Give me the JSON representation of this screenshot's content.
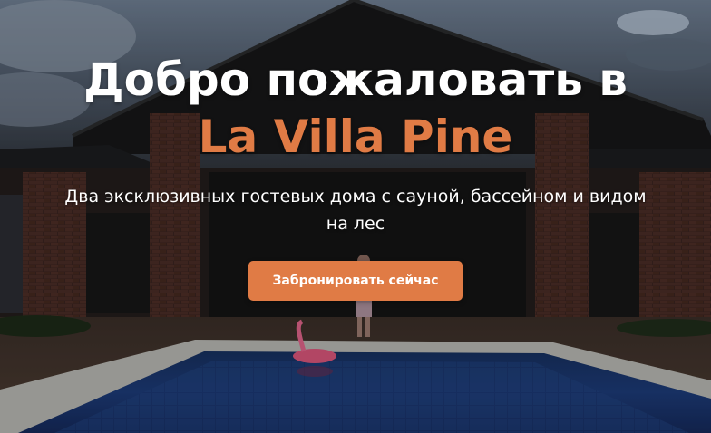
{
  "hero": {
    "title_line1": "Добро пожаловать в",
    "title_line2": "La Villa Pine",
    "subtitle": "Два эксклюзивных гостевых дома с сауной, бассейном и видом на лес",
    "cta_label": "Забронировать сейчас"
  },
  "colors": {
    "accent": "#e07b45",
    "text": "#ffffff"
  },
  "icons": {
    "background": "villa-pool-photo"
  }
}
